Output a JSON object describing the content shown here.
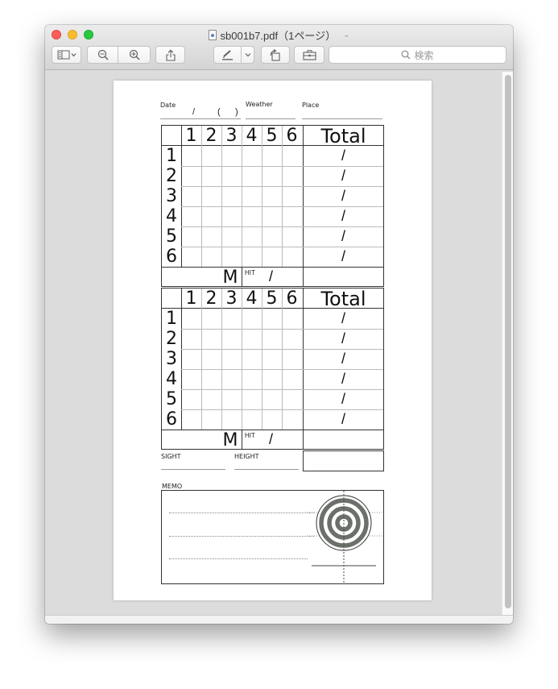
{
  "window": {
    "title": "sb001b7.pdf（1ページ）",
    "title_chevron": "⌄"
  },
  "toolbar": {
    "sidebar_icon": "sidebar-icon",
    "zoom_out_icon": "zoom-out-icon",
    "zoom_in_icon": "zoom-in-icon",
    "share_icon": "share-icon",
    "markup_icon": "pen-icon",
    "rotate_icon": "rotate-icon",
    "toolbox_icon": "toolbox-icon",
    "search_placeholder": "検索"
  },
  "colors": {
    "close": "#fc5f57",
    "minimize": "#fdbc2e",
    "zoom": "#28c840",
    "target_ring": "#6b706b"
  },
  "page": {
    "header": {
      "date_label": "Date",
      "date_slash": "/",
      "date_parens": "(      )",
      "weather_label": "Weather",
      "place_label": "Place"
    },
    "cards": [
      {
        "columns": [
          "1",
          "2",
          "3",
          "4",
          "5",
          "6"
        ],
        "total_label": "Total",
        "rows": [
          "1",
          "2",
          "3",
          "4",
          "5",
          "6"
        ],
        "row_total": "/",
        "m_label": "M",
        "hit_label": "HIT",
        "hit_slash": "/"
      },
      {
        "columns": [
          "1",
          "2",
          "3",
          "4",
          "5",
          "6"
        ],
        "total_label": "Total",
        "rows": [
          "1",
          "2",
          "3",
          "4",
          "5",
          "6"
        ],
        "row_total": "/",
        "m_label": "M",
        "hit_label": "HIT",
        "hit_slash": "/"
      }
    ],
    "sight_label": "SIGHT",
    "height_label": "HEIGHT",
    "memo_label": "MEMO"
  }
}
